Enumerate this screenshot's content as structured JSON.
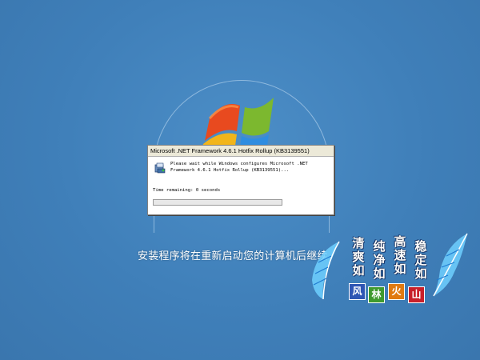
{
  "dialog": {
    "title": "Microsoft .NET Framework 4.6.1 Hotfix Rollup (KB3139551)",
    "message": "Please wait while Windows configures Microsoft .NET Framework 4.6.1 Hotfix Rollup (KB3139551)...",
    "time_remaining": "Time remaining: 0 seconds",
    "progress": 0
  },
  "status_message": "安装程序将在重新启动您的计算机后继续",
  "branding": {
    "columns": [
      [
        "清",
        "爽",
        "如"
      ],
      [
        "纯",
        "净",
        "如"
      ],
      [
        "高",
        "速",
        "如"
      ],
      [
        "稳",
        "定",
        "如"
      ]
    ],
    "tiles": [
      {
        "text": "风",
        "color": "#2f56b4"
      },
      {
        "text": "林",
        "color": "#3f9a2e"
      },
      {
        "text": "火",
        "color": "#e07a10"
      },
      {
        "text": "山",
        "color": "#c8202a"
      }
    ]
  },
  "icons": [
    "windows-flag-logo",
    "installer-icon",
    "feather-icon"
  ]
}
